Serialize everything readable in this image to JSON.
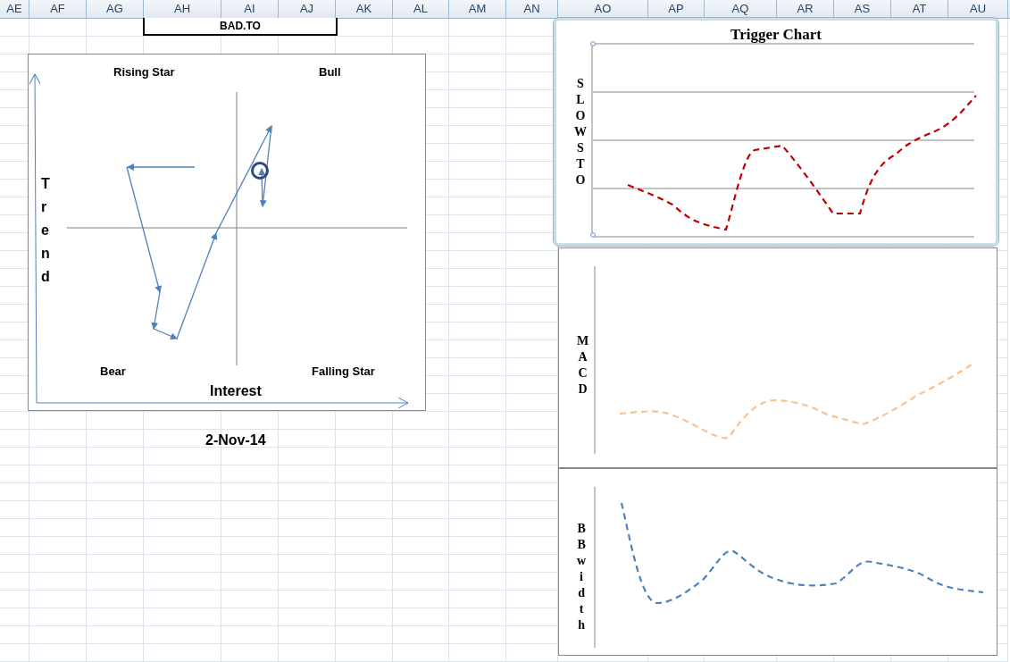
{
  "sheet": {
    "columns": [
      "AE",
      "AF",
      "AG",
      "AH",
      "AI",
      "AJ",
      "AK",
      "AL",
      "AM",
      "AN",
      "AO",
      "AP",
      "AQ",
      "AR",
      "AS",
      "AT",
      "AU"
    ]
  },
  "ticker_cell": "BAD.TO",
  "quadrant_chart": {
    "quadrant_labels": [
      "Rising Star",
      "Bull",
      "Bear",
      "Falling Star"
    ],
    "x_axis_label": "Interest",
    "y_axis_label": "Trend"
  },
  "date_cell": "2-Nov-14",
  "trigger_chart": {
    "title": "Trigger Chart",
    "panels": [
      {
        "label": "SLOW STO",
        "color": "#c00000",
        "selected": true
      },
      {
        "label": "MACD",
        "color": "#fac090",
        "selected": false
      },
      {
        "label": "BBwidth",
        "color": "#4f81bd",
        "selected": false
      }
    ]
  }
}
